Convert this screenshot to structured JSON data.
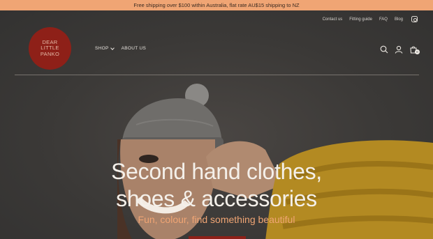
{
  "announcement": "Free shipping over $100 within Australia, flat rate AU$15 shipping to NZ",
  "utility_nav": [
    "Contact us",
    "Fitting guide",
    "FAQ",
    "Blog"
  ],
  "logo": {
    "text": "DEAR LITTLE PANKO"
  },
  "main_nav": {
    "shop": "SHOP",
    "about": "ABOUT US"
  },
  "cart": {
    "count": "0"
  },
  "hero": {
    "headline_line1": "Second hand clothes,",
    "headline_line2": "shoes & accessories",
    "subline": "Fun, colour, find something beautiful"
  },
  "colors": {
    "announce_bg": "#f0a574",
    "brand_red": "#8e2018",
    "accent_orange": "#f0a574",
    "dark_bg": "#3a3a3a"
  },
  "icons": [
    "instagram-icon",
    "search-icon",
    "account-icon",
    "cart-icon",
    "chevron-down-icon"
  ]
}
